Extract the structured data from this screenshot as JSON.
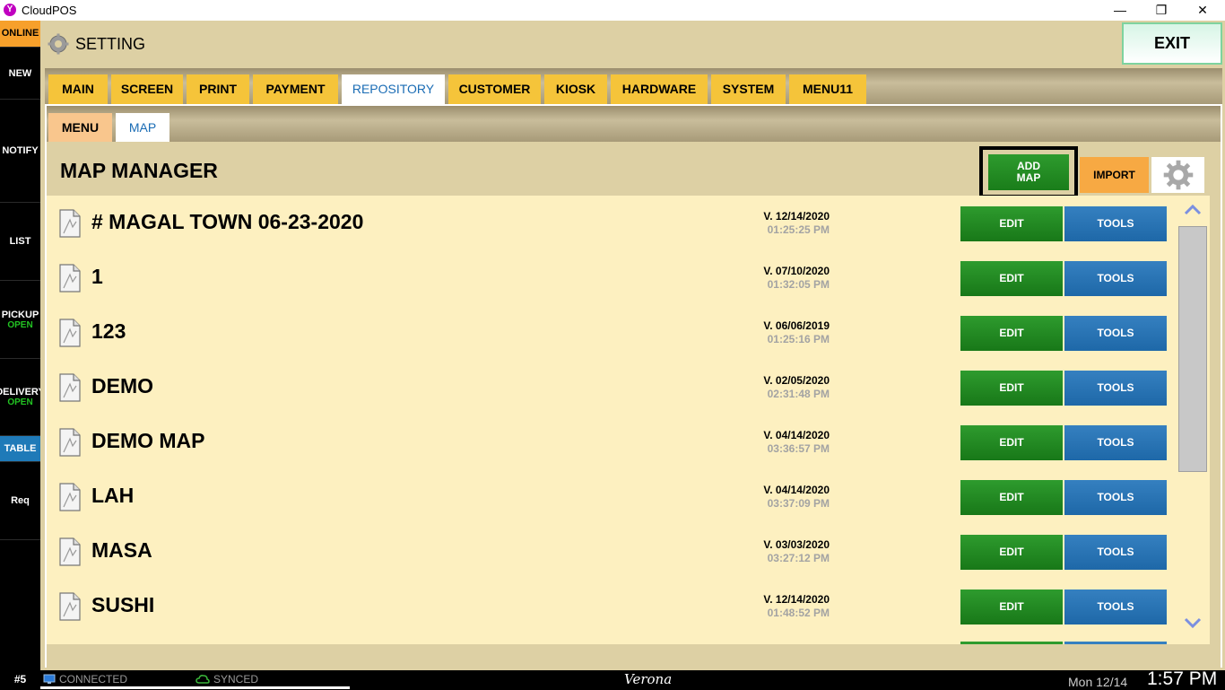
{
  "window": {
    "title": "CloudPOS",
    "app_icon_glyph": "Y",
    "minimize": "—",
    "maximize": "❐",
    "close": "✕"
  },
  "sidebar": {
    "online": "ONLINE",
    "items": [
      {
        "label": "NEW",
        "sub": ""
      },
      {
        "label": "NOTIFY",
        "sub": ""
      },
      {
        "label": "LIST",
        "sub": ""
      },
      {
        "label": "PICKUP",
        "sub": "OPEN"
      },
      {
        "label": "DELIVERY",
        "sub": "OPEN"
      },
      {
        "label": "TABLE",
        "sub": ""
      },
      {
        "label": "Req",
        "sub": ""
      }
    ]
  },
  "header": {
    "title": "SETTING",
    "exit_label": "EXIT"
  },
  "tabs": [
    "MAIN",
    "SCREEN",
    "PRINT",
    "PAYMENT",
    "REPOSITORY",
    "CUSTOMER",
    "KIOSK",
    "HARDWARE",
    "SYSTEM",
    "MENU11"
  ],
  "active_tab": "REPOSITORY",
  "subtabs": [
    "MENU",
    "MAP"
  ],
  "active_subtab": "MAP",
  "map_manager": {
    "title": "MAP MANAGER",
    "add_map_label_1": "ADD",
    "add_map_label_2": "MAP",
    "import_label": "IMPORT",
    "edit_label": "EDIT",
    "tools_label": "TOOLS",
    "maps": [
      {
        "name": "# MAGAL TOWN 06-23-2020",
        "version": "V. 12/14/2020",
        "time": "01:25:25 PM"
      },
      {
        "name": "1",
        "version": "V. 07/10/2020",
        "time": "01:32:05 PM"
      },
      {
        "name": "123",
        "version": "V. 06/06/2019",
        "time": "01:25:16 PM"
      },
      {
        "name": "DEMO",
        "version": "V. 02/05/2020",
        "time": "02:31:48 PM"
      },
      {
        "name": "DEMO MAP",
        "version": "V. 04/14/2020",
        "time": "03:36:57 PM"
      },
      {
        "name": "LAH",
        "version": "V. 04/14/2020",
        "time": "03:37:09 PM"
      },
      {
        "name": "MASA",
        "version": "V. 03/03/2020",
        "time": "03:27:12 PM"
      },
      {
        "name": "SUSHI",
        "version": "V. 12/14/2020",
        "time": "01:48:52 PM"
      }
    ]
  },
  "statusbar": {
    "station": "#5",
    "connected": "CONNECTED",
    "synced": "SYNCED",
    "store": "Verona",
    "date": "Mon 12/14",
    "time": "1:57 PM"
  },
  "colors": {
    "accent_green": "#1a7d1a",
    "accent_blue": "#1e68a8",
    "tab_yellow": "#f5c43a",
    "online_orange": "#f7a02b"
  }
}
